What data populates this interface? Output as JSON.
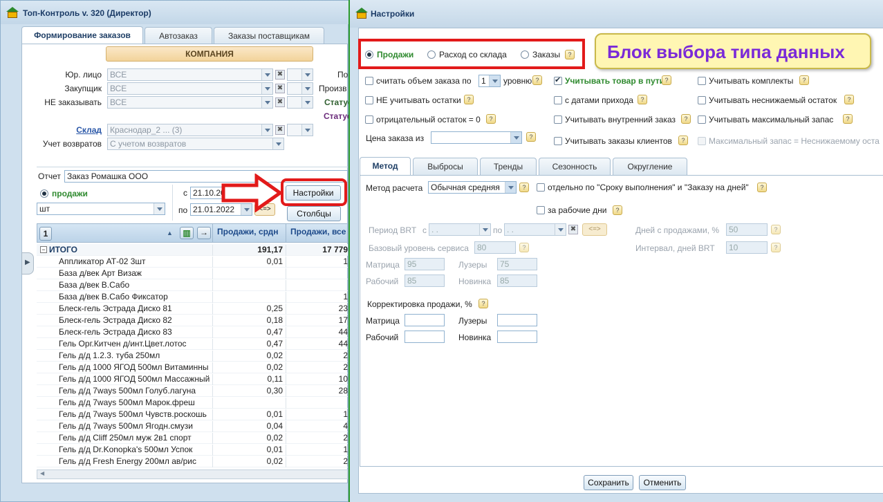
{
  "left_window": {
    "title": "Топ-Контроль v. 320 (Директор)",
    "tabs": [
      "Формирование заказов",
      "Автозаказ",
      "Заказы поставщикам"
    ],
    "company_header": "КОМПАНИЯ",
    "filters": [
      {
        "label": "Юр. лицо",
        "value": "ВСЕ"
      },
      {
        "label": "Закупщик",
        "value": "ВСЕ"
      },
      {
        "label": "НЕ заказывать",
        "value": "ВСЕ"
      }
    ],
    "right_cut_labels": [
      "По",
      "Произв",
      "Статус",
      "Статус"
    ],
    "warehouse_label": "Склад",
    "warehouse_value": "Краснодар_2 ... (3)",
    "returns_label": "Учет возвратов",
    "returns_value": "С учетом возвратов",
    "report_label": "Отчет",
    "report_value": "Заказ Ромашка ООО",
    "sales_radio": "продажи",
    "unit_value": "шт",
    "from_label": "с",
    "from_date": "21.10.20",
    "to_label": "по",
    "to_date": "21.01.2022",
    "swap_label": "<=>",
    "settings_button": "Настройки",
    "columns_button": "Столбцы",
    "page_badge": "1",
    "grid_headers": [
      "Продажи, срдн",
      "Продажи, все"
    ],
    "total_label": "ИТОГО",
    "total_values": [
      "191,17",
      "17 779"
    ],
    "rows": [
      {
        "name": "Аппликатор АТ-02 3шт",
        "v1": "0,01",
        "v2": "1"
      },
      {
        "name": "База д/век Арт Визаж",
        "v1": "",
        "v2": ""
      },
      {
        "name": "База д/век В.Сабо",
        "v1": "",
        "v2": ""
      },
      {
        "name": "База д/век В.Сабо Фиксатор",
        "v1": "",
        "v2": "1"
      },
      {
        "name": "Блеск-гель Эстрада Диско 81",
        "v1": "0,25",
        "v2": "23"
      },
      {
        "name": "Блеск-гель Эстрада Диско 82",
        "v1": "0,18",
        "v2": "17"
      },
      {
        "name": "Блеск-гель Эстрада Диско 83",
        "v1": "0,47",
        "v2": "44"
      },
      {
        "name": "Гель Орг.Китчен д/инт.Цвет.лотос",
        "v1": "0,47",
        "v2": "44"
      },
      {
        "name": "Гель д/д 1.2.3. туба 250мл",
        "v1": "0,02",
        "v2": "2"
      },
      {
        "name": "Гель д/д 1000 ЯГОД 500мл Витаминны",
        "v1": "0,02",
        "v2": "2"
      },
      {
        "name": "Гель д/д 1000 ЯГОД 500мл Массажный",
        "v1": "0,11",
        "v2": "10"
      },
      {
        "name": "Гель д/д 7ways 500мл Голуб.лагуна",
        "v1": "0,30",
        "v2": "28"
      },
      {
        "name": "Гель д/д 7ways 500мл Марок.фреш",
        "v1": "",
        "v2": ""
      },
      {
        "name": "Гель д/д 7ways 500мл Чувств.роскошь",
        "v1": "0,01",
        "v2": "1"
      },
      {
        "name": "Гель д/д 7ways 500мл Ягодн.смузи",
        "v1": "0,04",
        "v2": "4"
      },
      {
        "name": "Гель д/д Cliff 250мл муж 2в1 спорт",
        "v1": "0,02",
        "v2": "2"
      },
      {
        "name": "Гель д/д Dr.Konopka's 500мл Успок",
        "v1": "0,01",
        "v2": "1"
      },
      {
        "name": "Гель д/д Fresh Energy 200мл ав/рис",
        "v1": "0,02",
        "v2": "2"
      }
    ]
  },
  "settings_window": {
    "title": "Настройки",
    "callout": "Блок выбора типа данных",
    "data_type": {
      "options": [
        "Продажи",
        "Расход со склада",
        "Заказы"
      ],
      "selected": "Продажи"
    },
    "col1": {
      "volume_by_level_pre": "считать объем заказа по",
      "level_value": "1",
      "volume_by_level_post": "уровню",
      "ignore_stock": "НЕ учитывать остатки",
      "negative_zero": "отрицательный остаток = 0",
      "price_from": "Цена заказа из"
    },
    "col2": {
      "in_transit": "Учитывать товар в пути",
      "with_arrival_dates": "с датами прихода",
      "internal_order": "Учитывать внутренний заказ",
      "client_orders": "Учитывать заказы клиентов"
    },
    "col3": {
      "kits": "Учитывать комплекты",
      "min_stock": "Учитывать неснижаемый остаток",
      "max_stock": "Учитывать максимальный запас",
      "max_eq_min": "Максимальный запас = Неснижаемому оста"
    },
    "tabs": [
      "Метод",
      "Выбросы",
      "Тренды",
      "Сезонность",
      "Округление"
    ],
    "method_label": "Метод расчета",
    "method_value": "Обычная средняя",
    "separately": "отдельно по \"Сроку выполнения\" и \"Заказу на дней\"",
    "working_days": "за рабочие дни",
    "brt_period": "Период BRT",
    "brt_from": "с",
    "brt_to": "по",
    "date_placeholder": ". .",
    "swap": "<=>",
    "days_with_sales": "Дней с продажами, %",
    "days_with_sales_value": "50",
    "service_level": "Базовый уровень сервиса",
    "service_level_value": "80",
    "brt_interval": "Интервал, дней BRT",
    "brt_interval_value": "10",
    "matrix": "Матрица",
    "matrix_value": "95",
    "losers": "Лузеры",
    "losers_value": "75",
    "working": "Рабочий",
    "working_value": "85",
    "novelty": "Новинка",
    "novelty_value": "85",
    "correction_label": "Корректировка продажи, %",
    "save": "Сохранить",
    "cancel": "Отменить"
  },
  "colors": {
    "highlight": "#e21a1a",
    "callout_text": "#7a2ad8",
    "green_label": "#2f8a2f"
  }
}
